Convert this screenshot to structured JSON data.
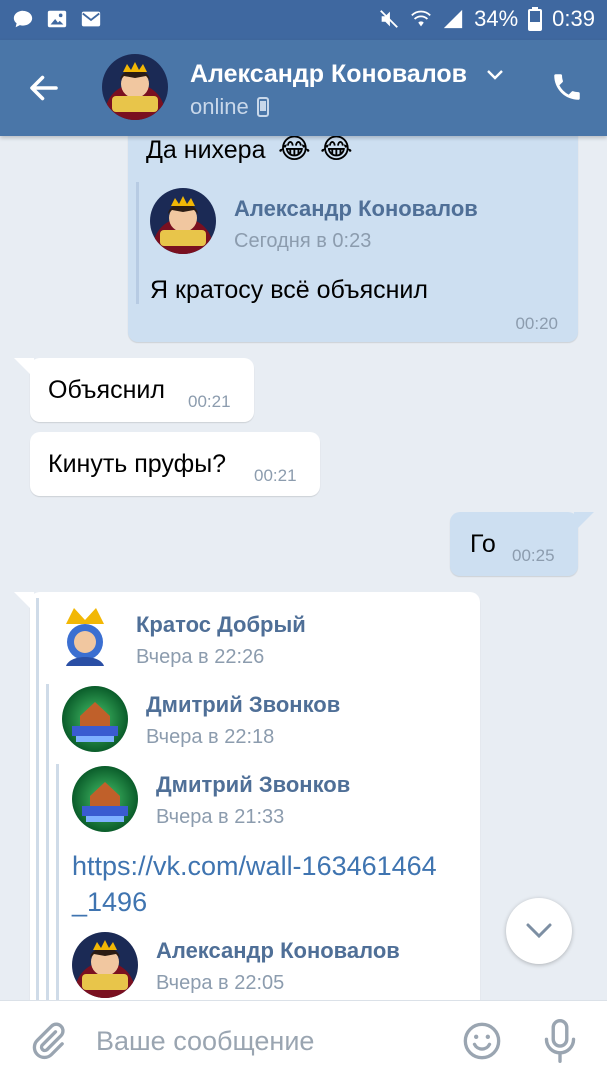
{
  "status_bar": {
    "battery": "34%",
    "time": "0:39"
  },
  "header": {
    "title": "Александр Коновалов",
    "status": "online"
  },
  "messages": {
    "m1": {
      "text": "Да нихера",
      "fwd": {
        "name": "Александр Коновалов",
        "date": "Сегодня в 0:23",
        "text": "Я кратосу всё объяснил"
      },
      "time": "00:20"
    },
    "m2": {
      "text": "Объяснил",
      "time": "00:21"
    },
    "m3": {
      "text": "Кинуть пруфы?",
      "time": "00:21"
    },
    "m4": {
      "text": "Го",
      "time": "00:25"
    },
    "m5": {
      "fwd1": {
        "name": "Кратос Добрый",
        "date": "Вчера в 22:26"
      },
      "fwd2": {
        "name": "Дмитрий Звонков",
        "date": "Вчера в 22:18"
      },
      "fwd3": {
        "name": "Дмитрий Звонков",
        "date": "Вчера в 21:33"
      },
      "link_line1": "https://vk.com/wall-163461464",
      "link_line2": "_1496",
      "fwd4": {
        "name": "Александр Коновалов",
        "date": "Вчера в 22:05"
      }
    }
  },
  "input": {
    "placeholder": "Ваше сообщение"
  },
  "colors": {
    "header": "#4a76a8",
    "status_bar": "#3f68a0",
    "outgoing_bubble": "#cddff1",
    "incoming_bubble": "#ffffff",
    "link": "#3f74b0"
  }
}
